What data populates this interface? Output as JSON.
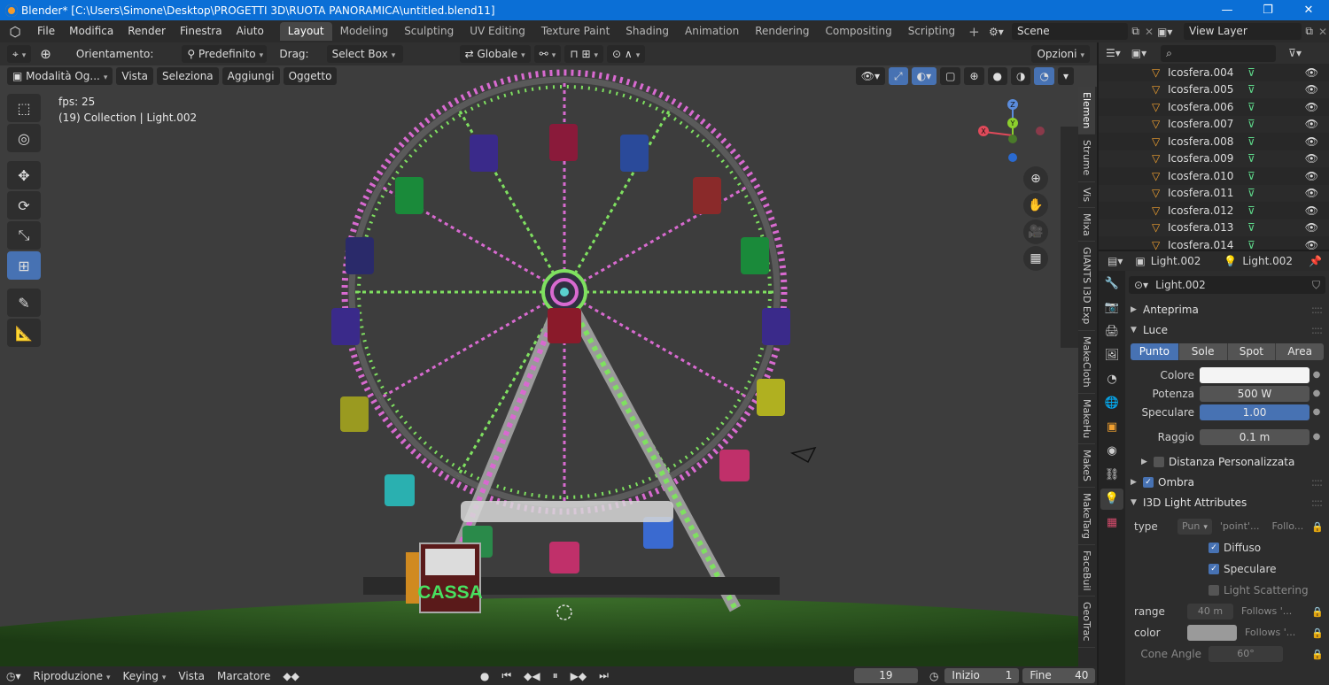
{
  "window": {
    "title": "Blender* [C:\\Users\\Simone\\Desktop\\PROGETTI 3D\\RUOTA PANORAMICA\\untitled.blend11]",
    "controls": [
      "—",
      "❐",
      "✕"
    ]
  },
  "menu": [
    "File",
    "Modifica",
    "Render",
    "Finestra",
    "Aiuto"
  ],
  "workspaces": [
    "Layout",
    "Modeling",
    "Sculpting",
    "UV Editing",
    "Texture Paint",
    "Shading",
    "Animation",
    "Rendering",
    "Compositing",
    "Scripting"
  ],
  "active_workspace": "Layout",
  "scene": {
    "name": "Scene",
    "view_layer": "View Layer"
  },
  "viewport": {
    "orientation_label": "Orientamento:",
    "orientation_value": "Predefinito",
    "drag_label": "Drag:",
    "drag_value": "Select Box",
    "transform_space": "Globale",
    "options": "Opzioni",
    "mode": "Modalità Og...",
    "menus": [
      "Vista",
      "Seleziona",
      "Aggiungi",
      "Oggetto"
    ],
    "fps": "fps: 25",
    "context": "(19) Collection | Light.002",
    "sign_text": "CASSA",
    "gizmo_axes": [
      "X",
      "Y",
      "Z"
    ]
  },
  "sidebar_tabs": [
    "Elemen",
    "Strume",
    "Vis",
    "Mixa",
    "GIANTS I3D Exp",
    "MakeCloth",
    "MakeHu",
    "MakeS",
    "MakeTarg",
    "FaceBuil",
    "GeoTrac"
  ],
  "outliner": {
    "rows": [
      "Icosfera.004",
      "Icosfera.005",
      "Icosfera.006",
      "Icosfera.007",
      "Icosfera.008",
      "Icosfera.009",
      "Icosfera.010",
      "Icosfera.011",
      "Icosfera.012",
      "Icosfera.013",
      "Icosfera.014"
    ]
  },
  "properties": {
    "object_name": "Light.002",
    "data_name": "Light.002",
    "datablock": "Light.002",
    "panels": {
      "preview": "Anteprima",
      "light": "Luce",
      "custom_distance": "Distanza Personalizzata",
      "shadow": "Ombra",
      "i3d": "I3D Light Attributes"
    },
    "light_types": [
      "Punto",
      "Sole",
      "Spot",
      "Area"
    ],
    "active_light_type": "Punto",
    "color_label": "Colore",
    "color_value": "#f4f4f4",
    "power_label": "Potenza",
    "power_value": "500 W",
    "specular_label": "Speculare",
    "specular_value": "1.00",
    "radius_label": "Raggio",
    "radius_value": "0.1 m",
    "i3d": {
      "type_label": "type",
      "type_values": [
        "Pun",
        "'point'...",
        "Follo..."
      ],
      "diffuse": "Diffuso",
      "specular": "Speculare",
      "scattering": "Light Scattering",
      "range_label": "range",
      "range_value": "40 m",
      "range_follow": "Follows '...",
      "color_label": "color",
      "color_follow": "Follows '...",
      "cone_label": "Cone Angle",
      "cone_value": "60°"
    }
  },
  "timeline": {
    "menus": [
      "Riproduzione",
      "Keying",
      "Vista",
      "Marcatore"
    ],
    "current_frame": "19",
    "start_label": "Inizio",
    "start_value": "1",
    "end_label": "Fine",
    "end_value": "40"
  }
}
